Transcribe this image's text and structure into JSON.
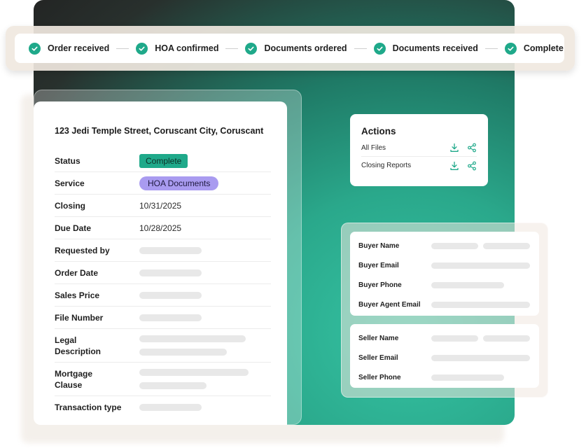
{
  "progress": {
    "steps": [
      {
        "label": "Order received",
        "done": true
      },
      {
        "label": "HOA confirmed",
        "done": true
      },
      {
        "label": "Documents ordered",
        "done": true
      },
      {
        "label": "Documents received",
        "done": true
      },
      {
        "label": "Complete",
        "done": true
      }
    ]
  },
  "order": {
    "address": "123 Jedi Temple Street, Coruscant City, Coruscant",
    "rows": [
      {
        "label": "Status",
        "value": "Complete"
      },
      {
        "label": "Service",
        "value": "HOA Documents"
      },
      {
        "label": "Closing",
        "value": "10/31/2025"
      },
      {
        "label": "Due Date",
        "value": "10/28/2025"
      },
      {
        "label": "Requested by",
        "value": ""
      },
      {
        "label": "Order Date",
        "value": ""
      },
      {
        "label": "Sales Price",
        "value": ""
      },
      {
        "label": "File Number",
        "value": ""
      },
      {
        "label": "Legal\nDescription",
        "value": ""
      },
      {
        "label": "Mortgage\nClause",
        "value": ""
      },
      {
        "label": "Transaction type",
        "value": ""
      }
    ]
  },
  "actions": {
    "title": "Actions",
    "items": [
      {
        "label": "All Files",
        "icons": [
          "download-icon",
          "share-icon"
        ]
      },
      {
        "label": "Closing Reports",
        "icons": [
          "download-icon",
          "share-icon"
        ]
      }
    ]
  },
  "buyer": {
    "fields": [
      "Buyer Name",
      "Buyer Email",
      "Buyer Phone",
      "Buyer Agent Email"
    ]
  },
  "seller": {
    "fields": [
      "Seller Name",
      "Seller Email",
      "Seller Phone"
    ]
  },
  "colors": {
    "accent": "#1fa98a",
    "service_badge": "#a99bf0",
    "background_teal": "#35c3a3"
  }
}
